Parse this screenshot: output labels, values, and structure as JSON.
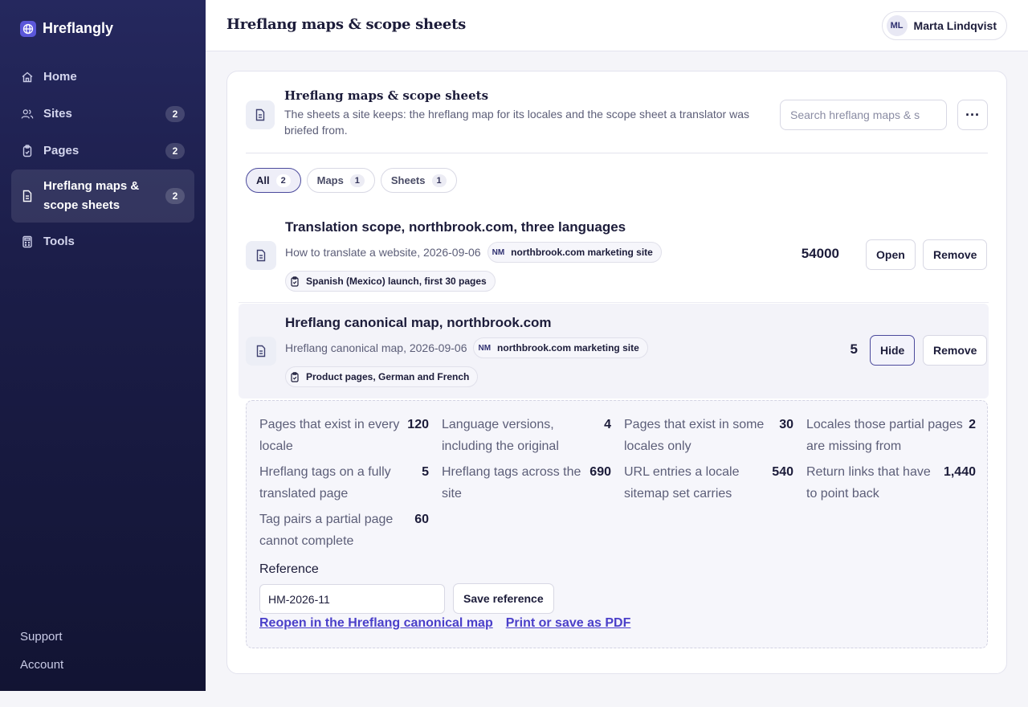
{
  "app": {
    "name": "Hreflangly"
  },
  "sidebar": {
    "items": [
      {
        "label": "Home",
        "icon": "home-icon"
      },
      {
        "label": "Sites",
        "icon": "users-icon",
        "count": "2"
      },
      {
        "label": "Pages",
        "icon": "clipboard-icon",
        "count": "2"
      },
      {
        "label": "Hreflang maps & scope sheets",
        "icon": "document-icon",
        "count": "2",
        "active": true
      },
      {
        "label": "Tools",
        "icon": "calculator-icon"
      }
    ],
    "footer": {
      "support": "Support",
      "account": "Account"
    }
  },
  "topbar": {
    "title": "Hreflang maps & scope sheets",
    "user": {
      "initials": "ML",
      "name": "Marta Lindqvist"
    }
  },
  "card": {
    "title": "Hreflang maps & scope sheets",
    "description": "The sheets a site keeps: the hreflang map for its locales and the scope sheet a translator was briefed from.",
    "search_placeholder": "Search hreflang maps & s",
    "more_label": "···"
  },
  "tabs": [
    {
      "label": "All",
      "count": "2",
      "active": true
    },
    {
      "label": "Maps",
      "count": "1"
    },
    {
      "label": "Sheets",
      "count": "1"
    }
  ],
  "rows": [
    {
      "title": "Translation scope, northbrook.com, three languages",
      "meta": "How to translate a website, 2026-09-06",
      "site_initials": "NM",
      "site": "northbrook.com marketing site",
      "page": "Spanish (Mexico) launch, first 30 pages",
      "count": "54000",
      "primary_action": "Open",
      "secondary_action": "Remove"
    },
    {
      "title": "Hreflang canonical map, northbrook.com",
      "meta": "Hreflang canonical map, 2026-09-06",
      "site_initials": "NM",
      "site": "northbrook.com marketing site",
      "page": "Product pages, German and French",
      "count": "5",
      "primary_action": "Hide",
      "secondary_action": "Remove"
    }
  ],
  "details": {
    "stats": [
      {
        "label": "Pages that exist in every locale",
        "value": "120"
      },
      {
        "label": "Language versions, including the original",
        "value": "4"
      },
      {
        "label": "Pages that exist in some locales only",
        "value": "30"
      },
      {
        "label": "Locales those partial pages are missing from",
        "value": "2"
      },
      {
        "label": "Hreflang tags on a fully translated page",
        "value": "5"
      },
      {
        "label": "Hreflang tags across the site",
        "value": "690"
      },
      {
        "label": "URL entries a locale sitemap set carries",
        "value": "540"
      },
      {
        "label": "Return links that have to point back",
        "value": "1,440"
      },
      {
        "label": "Tag pairs a partial page cannot complete",
        "value": "60"
      }
    ],
    "reference_label": "Reference",
    "reference_value": "HM-2026-11",
    "save_label": "Save reference",
    "link_reopen": "Reopen in the Hreflang canonical map",
    "link_print": "Print or save as PDF"
  },
  "colors": {
    "accent": "#4a3fc9",
    "sidebar": "#1b1d48",
    "selected_outline": "#4b4a9c"
  }
}
